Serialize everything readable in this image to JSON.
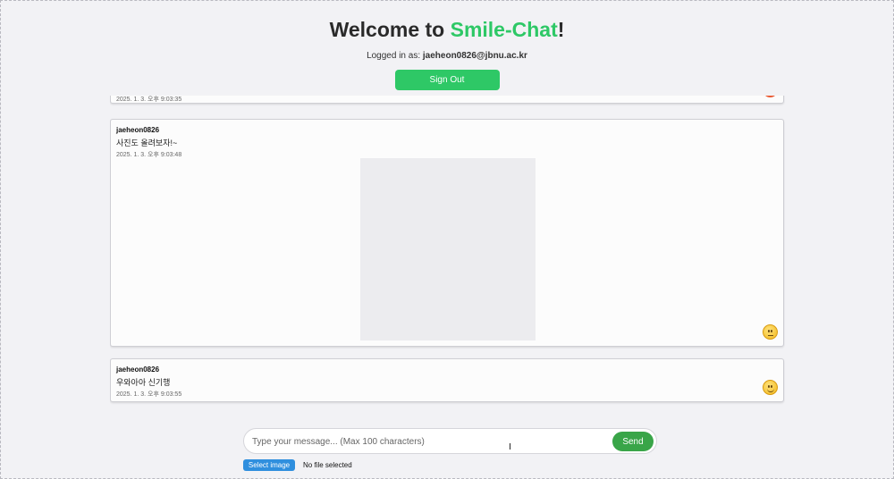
{
  "header": {
    "title_prefix": "Welcome to ",
    "title_brand": "Smile-Chat",
    "title_suffix": "!",
    "logged_in_label": "Logged in as: ",
    "logged_in_user": "jaeheon0826@jbnu.ac.kr",
    "sign_out_label": "Sign Out"
  },
  "messages": [
    {
      "user": "",
      "text": "",
      "time": "2025. 1. 3. 오후 9:03:35",
      "emoji_icon": "emoji-red-partial-icon"
    },
    {
      "user": "jaeheon0826",
      "text": "사진도 올려보자!~",
      "time": "2025. 1. 3. 오후 9:03:48",
      "has_image": true,
      "emoji_icon": "neutral-face-emoji-icon"
    },
    {
      "user": "jaeheon0826",
      "text": "우와아아 신기행",
      "time": "2025. 1. 3. 오후 9:03:55",
      "emoji_icon": "smiling-face-emoji-icon"
    }
  ],
  "composer": {
    "placeholder": "Type your message... (Max 100 characters)",
    "value": "",
    "send_label": "Send",
    "select_image_label": "Select image",
    "file_status": "No file selected"
  },
  "colors": {
    "brand": "#2ec866",
    "send": "#39a548",
    "select_image": "#2f8fde",
    "background": "#f2f2f5"
  }
}
